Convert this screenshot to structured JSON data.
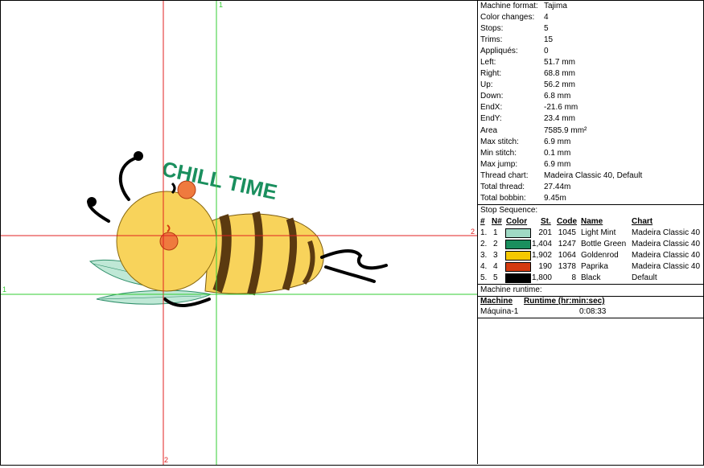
{
  "info": [
    {
      "key": "Machine format:",
      "value": "Tajima"
    },
    {
      "key": "Color changes:",
      "value": "4"
    },
    {
      "key": "Stops:",
      "value": "5"
    },
    {
      "key": "Trims:",
      "value": "15"
    },
    {
      "key": "Appliqués:",
      "value": "0"
    },
    {
      "key": "Left:",
      "value": "51.7 mm"
    },
    {
      "key": "Right:",
      "value": "68.8 mm"
    },
    {
      "key": "Up:",
      "value": "56.2 mm"
    },
    {
      "key": "Down:",
      "value": "6.8 mm"
    },
    {
      "key": "EndX:",
      "value": "-21.6 mm"
    },
    {
      "key": "EndY:",
      "value": "23.4 mm"
    },
    {
      "key": "Area",
      "value": "7585.9 mm²"
    },
    {
      "key": "Max stitch:",
      "value": "6.9 mm"
    },
    {
      "key": "Min stitch:",
      "value": "0.1 mm"
    },
    {
      "key": "Max jump:",
      "value": "6.9 mm"
    },
    {
      "key": "Thread chart:",
      "value": "Madeira Classic 40, Default"
    },
    {
      "key": "Total thread:",
      "value": "27.44m"
    },
    {
      "key": "Total bobbin:",
      "value": "9.45m"
    }
  ],
  "stop_sequence": {
    "title": "Stop Sequence:",
    "headers": {
      "hash": "#",
      "n": "N#",
      "color": "Color",
      "st": "St.",
      "code": "Code",
      "name": "Name",
      "chart": "Chart"
    },
    "rows": [
      {
        "idx": "1.",
        "n": "1",
        "color": "#9fd9c4",
        "st": "201",
        "code": "1045",
        "name": "Light Mint",
        "chart": "Madeira Classic 40"
      },
      {
        "idx": "2.",
        "n": "2",
        "color": "#1a8f5e",
        "st": "1,404",
        "code": "1247",
        "name": "Bottle Green",
        "chart": "Madeira Classic 40"
      },
      {
        "idx": "3.",
        "n": "3",
        "color": "#f5c800",
        "st": "1,902",
        "code": "1064",
        "name": "Goldenrod",
        "chart": "Madeira Classic 40"
      },
      {
        "idx": "4.",
        "n": "4",
        "color": "#d43a10",
        "st": "190",
        "code": "1378",
        "name": "Paprika",
        "chart": "Madeira Classic 40"
      },
      {
        "idx": "5.",
        "n": "5",
        "color": "#000000",
        "st": "1,800",
        "code": "8",
        "name": "Black",
        "chart": "Default"
      }
    ]
  },
  "runtime": {
    "title": "Machine runtime:",
    "headers": {
      "machine": "Machine",
      "runtime": "Runtime (hr:min:sec)"
    },
    "rows": [
      {
        "machine": "Máquina-1",
        "time": "0:08:33"
      }
    ]
  },
  "canvas": {
    "marker_1": "1",
    "marker_2": "2",
    "design_text": "CHILL TIME"
  },
  "colors": {
    "red_guide": "#e02020",
    "green_guide": "#33cc33"
  }
}
